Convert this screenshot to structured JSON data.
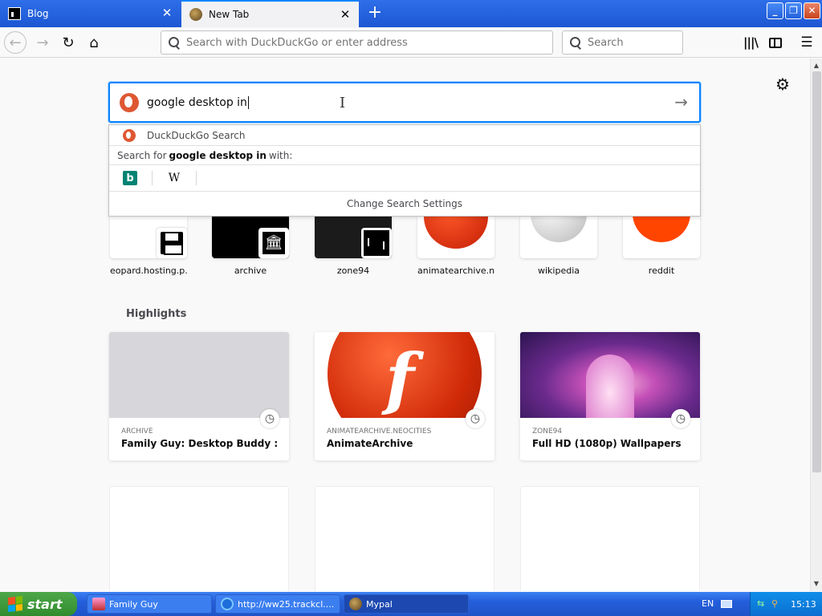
{
  "tabs": [
    {
      "title": "Blog",
      "active": false
    },
    {
      "title": "New Tab",
      "active": true
    }
  ],
  "window_controls": {
    "minimize": "_",
    "maximize": "❐",
    "close": "✕"
  },
  "navbar": {
    "url_placeholder": "Search with DuckDuckGo or enter address",
    "search_placeholder": "Search"
  },
  "search": {
    "value": "google desktop in",
    "suggestion_label": "DuckDuckGo Search",
    "search_for_prefix": "Search for",
    "search_for_query": "google desktop in",
    "search_for_suffix": "with:",
    "engines": [
      {
        "name": "Bing",
        "icon": "b"
      },
      {
        "name": "Wikipedia",
        "icon": "W"
      }
    ],
    "change_settings": "Change Search Settings"
  },
  "top_sites": [
    {
      "label": "eopard.hosting.p...",
      "icon": "floppy-icon"
    },
    {
      "label": "archive",
      "icon": "archive-icon"
    },
    {
      "label": "zone94",
      "icon": "pong-icon"
    },
    {
      "label": "animatearchive.n...",
      "icon": "flash-icon"
    },
    {
      "label": "wikipedia",
      "icon": "wikipedia-globe-icon"
    },
    {
      "label": "reddit",
      "icon": "reddit-icon"
    }
  ],
  "highlights": {
    "title": "Highlights",
    "cards": [
      {
        "source": "ARCHIVE",
        "title": "Family Guy: Desktop Buddy : Scr..."
      },
      {
        "source": "ANIMATEARCHIVE.NEOCITIES",
        "title": "AnimateArchive"
      },
      {
        "source": "ZONE94",
        "title": "Full HD (1080p) Wallpapers"
      }
    ]
  },
  "taskbar": {
    "start_label": "start",
    "tasks": [
      {
        "label": "Family Guy",
        "active": false
      },
      {
        "label": "http://ww25.trackcl....",
        "active": false
      },
      {
        "label": "Mypal",
        "active": true
      }
    ],
    "language": "EN",
    "clock": "15:13"
  }
}
